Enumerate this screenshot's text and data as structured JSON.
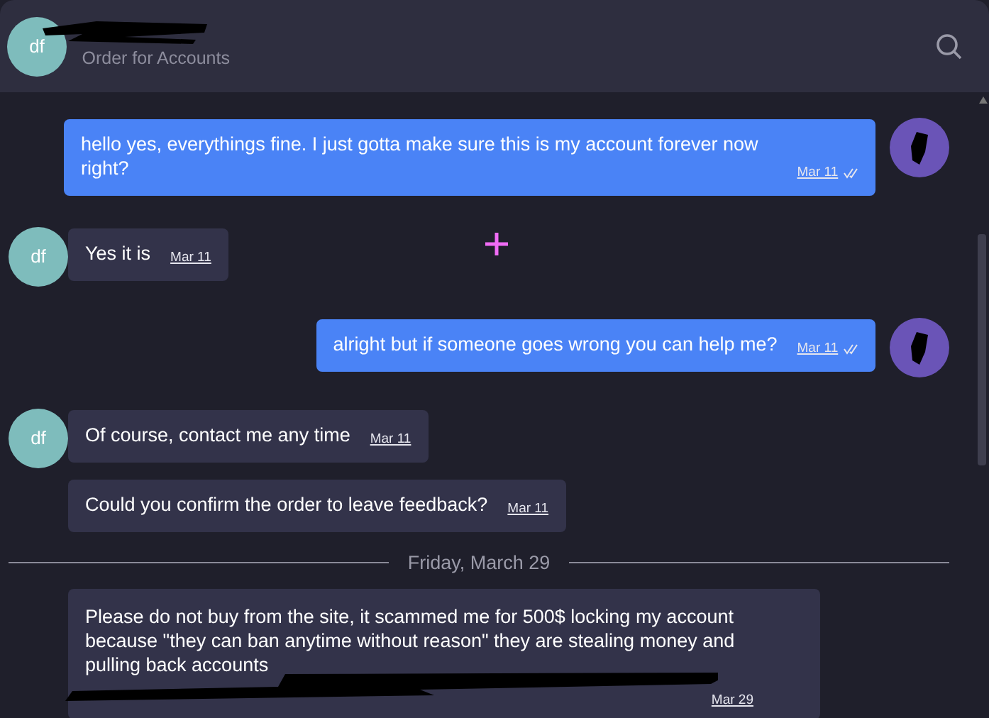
{
  "header": {
    "avatar_initials": "df",
    "subtitle": "Order for Accounts",
    "name_redacted": true
  },
  "messages": [
    {
      "kind": "sent",
      "text": "hello yes, everythings fine. I just gotta make sure this is my account forever now right?",
      "time": "Mar 11",
      "read": true,
      "show_avatar": true
    },
    {
      "kind": "received",
      "text": "Yes it is",
      "time": "Mar 11",
      "show_avatar": true,
      "initials": "df"
    },
    {
      "kind": "sent",
      "text": "alright but if someone goes wrong you can help me?",
      "time": "Mar 11",
      "read": true,
      "show_avatar": true
    },
    {
      "kind": "received",
      "text": "Of course, contact me any time",
      "time": "Mar 11",
      "show_avatar": true,
      "initials": "df"
    },
    {
      "kind": "received",
      "text": "Could you confirm the order to leave feedback?",
      "time": "Mar 11",
      "show_avatar": false
    },
    {
      "kind": "divider",
      "text": "Friday, March 29"
    },
    {
      "kind": "received",
      "text": "Please do not buy from the site, it scammed me for 500$ locking my account because \"they can ban anytime without reason\" they are stealing money and pulling back accounts",
      "time": "Mar 29",
      "show_avatar": false,
      "redacted": true
    }
  ]
}
